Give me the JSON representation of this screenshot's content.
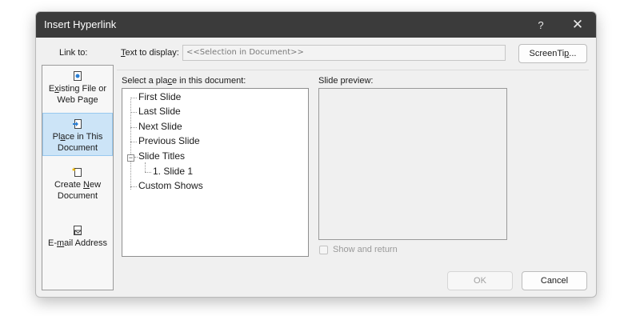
{
  "dialog": {
    "title": "Insert Hyperlink",
    "help_glyph": "?",
    "close_glyph": "✕"
  },
  "link_to": {
    "heading": "Link to:",
    "items": [
      {
        "pre": "E",
        "u": "x",
        "post": "isting File or",
        "line2": "Web Page",
        "icon": "existing-file-icon"
      },
      {
        "pre": "Pl",
        "u": "a",
        "post": "ce in This",
        "line2": "Document",
        "icon": "place-in-document-icon",
        "selected": true
      },
      {
        "pre": "Create ",
        "u": "N",
        "post": "ew",
        "line2": "Document",
        "icon": "new-document-icon"
      },
      {
        "pre": "E-",
        "u": "m",
        "post": "ail Address",
        "line2": "",
        "icon": "email-icon"
      }
    ]
  },
  "text_to_display": {
    "label_u": "T",
    "label_rest": "ext to display:",
    "value": "<<Selection in Document>>"
  },
  "screentip_button": {
    "pre": "ScreenTi",
    "u": "p",
    "post": "..."
  },
  "place_label": {
    "pre": "Select a pla",
    "u": "c",
    "post": "e in this document:"
  },
  "tree": {
    "items": [
      "First Slide",
      "Last Slide",
      "Next Slide",
      "Previous Slide",
      "Slide Titles",
      "1. Slide 1",
      "Custom Shows"
    ],
    "expander": "−"
  },
  "preview": {
    "label": "Slide preview:",
    "show_and_return": "Show and return"
  },
  "buttons": {
    "ok": "OK",
    "cancel": "Cancel"
  },
  "colors": {
    "titlebar": "#3b3b3b",
    "selected_bg": "#cce4f7",
    "dialog_bg": "#f0f0f0"
  }
}
